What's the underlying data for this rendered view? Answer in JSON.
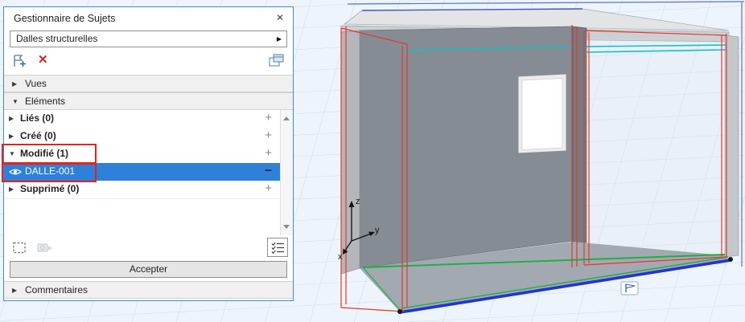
{
  "panel": {
    "title": "Gestionnaire de Sujets",
    "close_glyph": "✕",
    "filter_dropdown": {
      "value": "Dalles structurelles",
      "arrow_glyph": "▶"
    },
    "toolbar": {
      "delete_glyph": "✕"
    },
    "sections": [
      {
        "label": "Vues",
        "expander": "▶"
      },
      {
        "label": "Eléments",
        "expander": "▼"
      }
    ],
    "tree": {
      "rows": [
        {
          "label": "Liés (0)",
          "expander": "▶",
          "action": "+"
        },
        {
          "label": "Créé (0)",
          "expander": "▶",
          "action": "+"
        },
        {
          "label": "Modifié (1)",
          "expander": "▼",
          "action": "+",
          "annotated": true
        },
        {
          "label": "DALLE-001",
          "action": "−",
          "selected": true,
          "annotated": true
        },
        {
          "label": "Supprimé (0)",
          "expander": "▶",
          "action": "+"
        }
      ]
    },
    "footer": {
      "accept_label": "Accepter"
    },
    "comments_section": {
      "label": "Commentaires",
      "expander": "▶"
    }
  },
  "viewport": {
    "axis_labels": {
      "z": "z",
      "y": "y",
      "x": "x"
    }
  },
  "icons": {
    "new_topic": "flag-plus-icon",
    "delete_topic": "x-mark-icon",
    "topic_palette": "palette-icon",
    "close": "close-icon",
    "marquee": "marquee-icon",
    "capture": "capture-arrow-icon",
    "checklist": "checklist-icon",
    "item_visibility": "eye-icon",
    "viewport_marker": "flag-marker-icon"
  },
  "colors": {
    "selection_blue": "#2e80d8",
    "annotation_red": "#e0241c",
    "modified_wireframe_red": "#e8372c",
    "slab_edge_green": "#1fae4a",
    "slab_edge_blue": "#2133d6",
    "ceiling_edge_cyan": "#15bfc9",
    "grid_line": "#c7dcee",
    "panel_border_blue": "#3f87d8"
  }
}
